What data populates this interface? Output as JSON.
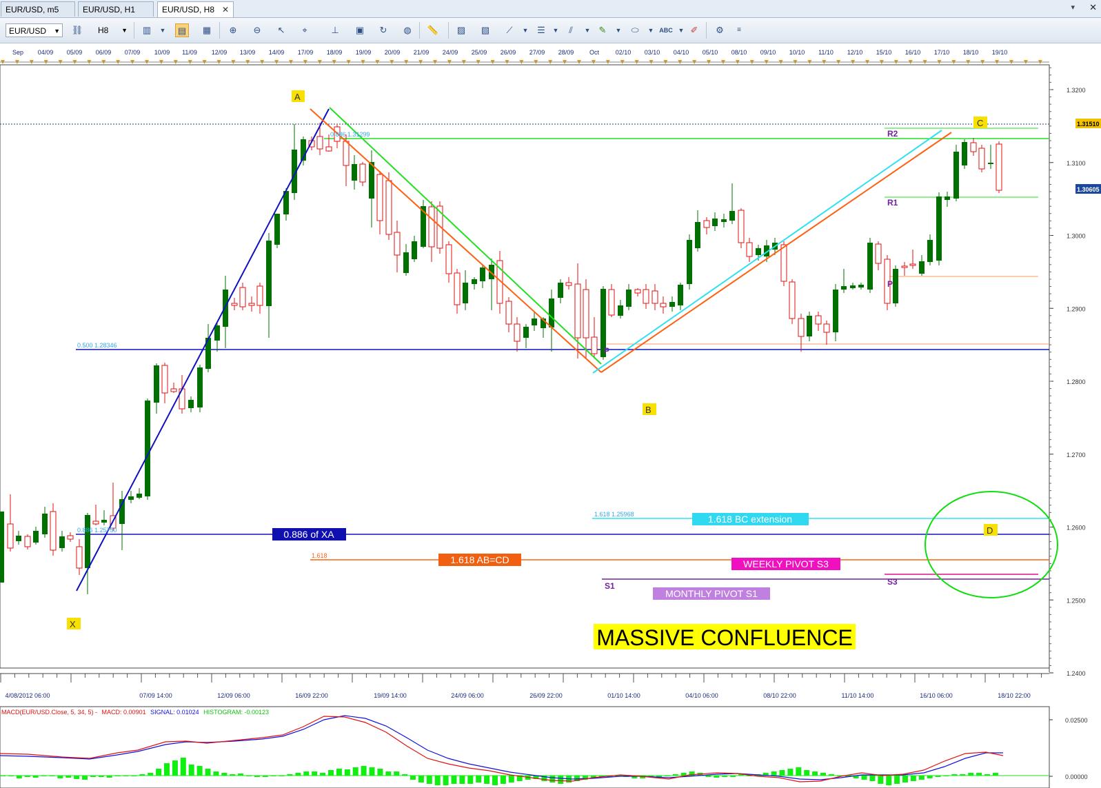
{
  "tabs": [
    {
      "label": "EUR/USD, m5",
      "active": false
    },
    {
      "label": "EUR/USD, H1",
      "active": false
    },
    {
      "label": "EUR/USD, H8",
      "active": true
    }
  ],
  "toolbar": {
    "symbol": "EUR/USD",
    "timeframe": "H8",
    "icons": [
      "chain-link-icon",
      "bar-chart-icon",
      "candlestick-icon",
      "line-chart-icon",
      "zoom-in-icon",
      "zoom-out-icon",
      "cursor-icon",
      "crosshair-icon",
      "period-separator-icon",
      "screenshot-icon",
      "refresh-icon",
      "globe-icon",
      "ruler-icon",
      "template-icon",
      "properties-icon",
      "draw-line-icon",
      "fibonacci-icon",
      "channel-icon",
      "pencil-icon",
      "ellipse-icon",
      "text-icon",
      "eraser-icon",
      "objects-list-icon",
      "more-icon"
    ]
  },
  "top_date_axis": [
    "Sep",
    "04/09",
    "05/09",
    "06/09",
    "07/09",
    "10/09",
    "11/09",
    "12/09",
    "13/09",
    "14/09",
    "17/09",
    "18/09",
    "19/09",
    "20/09",
    "21/09",
    "24/09",
    "25/09",
    "26/09",
    "27/09",
    "28/09",
    "Oct",
    "02/10",
    "03/10",
    "04/10",
    "05/10",
    "08/10",
    "09/10",
    "10/10",
    "11/10",
    "12/10",
    "15/10",
    "16/10",
    "17/10",
    "18/10",
    "19/10"
  ],
  "bottom_time_axis": [
    "4/08/2012 06:00",
    "07/09 14:00",
    "12/09 06:00",
    "16/09 22:00",
    "19/09 14:00",
    "24/09 06:00",
    "26/09 22:00",
    "01/10 14:00",
    "04/10 06:00",
    "08/10 22:00",
    "11/10 14:00",
    "16/10 06:00",
    "18/10 22:00"
  ],
  "price_axis": [
    "1.3200",
    "1.3100",
    "1.3000",
    "1.2900",
    "1.2800",
    "1.2700",
    "1.2600",
    "1.2500",
    "1.2400"
  ],
  "price_tags": {
    "upper": "1.31510",
    "lower": "1.30605"
  },
  "pattern_points": {
    "x": "X",
    "a": "A",
    "b": "B",
    "c": "C",
    "d": "D"
  },
  "pivot_labels": {
    "r2": "R2",
    "r1": "R1",
    "p_weekly": "P",
    "p_daily": "P",
    "s1": "S1",
    "s3": "S3"
  },
  "fib_labels": {
    "fib_0886_high": "0.886 1.31299",
    "fib_0500": "0.500 1.28346",
    "fib_0886_low": "0.886 1.25750",
    "fib_1618_bc": "1.618 1.25968",
    "fib_1618_abcd": "1.618"
  },
  "annotations": {
    "xa_0886": "0.886 of XA",
    "bc_ext": "1.618 BC extension",
    "abcd": "1.618 AB=CD",
    "weekly_s3": "WEEKLY PIVOT S3",
    "monthly_s1": "MONTHLY PIVOT S1",
    "confluence": "MASSIVE CONFLUENCE"
  },
  "macd": {
    "title": "MACD(EUR/USD.Close, 5, 34, 5) -",
    "macd_label": "MACD: 0.00901",
    "signal_label": "SIGNAL: 0.01024",
    "histogram_label": "HISTOGRAM: -0.00123",
    "axis": [
      "0.02500",
      "0.00000"
    ]
  },
  "colors": {
    "bull_candle": "#007000",
    "bear_candle": "#e01010",
    "xa_line": "#1010c0",
    "orange_line": "#ff6010",
    "green_line": "#20e020",
    "cyan_line": "#30e0f0",
    "pivot_purple": "#7020a0",
    "confluence_bg": "#ffff00",
    "d_circle": "#10dd10"
  }
}
